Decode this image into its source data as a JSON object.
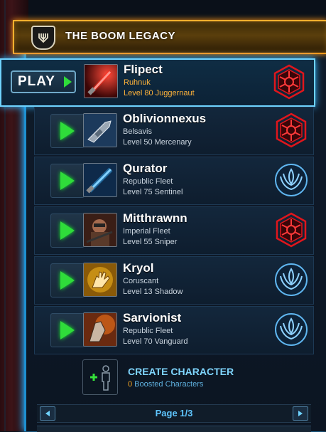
{
  "legacy": {
    "title": "THE BOOM LEGACY"
  },
  "play_button_label": "PLAY",
  "characters": [
    {
      "name": "Flipect",
      "location": "Ruhnuk",
      "level": "Level 80 Juggernaut",
      "faction": "sith",
      "portrait": "red-lightsaber-icon",
      "selected": true
    },
    {
      "name": "Oblivionnexus",
      "location": "Belsavis",
      "level": "Level 50 Mercenary",
      "faction": "sith",
      "portrait": "blaster-icon",
      "selected": false
    },
    {
      "name": "Qurator",
      "location": "Republic Fleet",
      "level": "Level 75 Sentinel",
      "faction": "republic",
      "portrait": "blue-lightsaber-icon",
      "selected": false
    },
    {
      "name": "Mitthrawnn",
      "location": "Imperial Fleet",
      "level": "Level 55 Sniper",
      "faction": "sith",
      "portrait": "sniper-icon",
      "selected": false
    },
    {
      "name": "Kryol",
      "location": "Coruscant",
      "level": "Level 13 Shadow",
      "faction": "republic",
      "portrait": "force-hand-icon",
      "selected": false
    },
    {
      "name": "Sarvionist",
      "location": "Republic Fleet",
      "level": "Level 70 Vanguard",
      "faction": "republic",
      "portrait": "vanguard-icon",
      "selected": false
    }
  ],
  "create": {
    "title": "CREATE CHARACTER",
    "boosted_count": "0",
    "boosted_label": " Boosted Characters"
  },
  "pager": {
    "label": "Page 1/3"
  },
  "colors": {
    "sith": "#e0161c",
    "republic": "#5fb6f0",
    "play": "#2fdc3a",
    "accent": "#ffb02e"
  }
}
